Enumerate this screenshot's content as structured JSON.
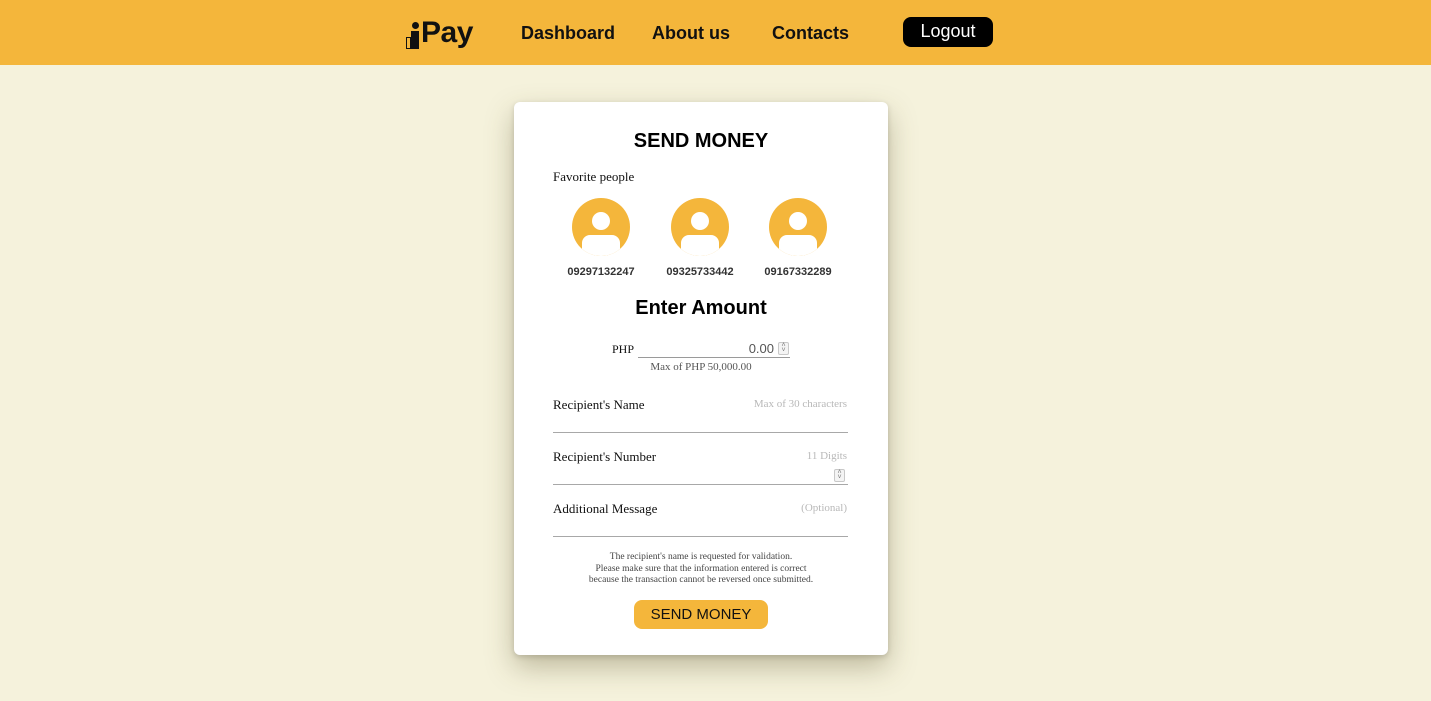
{
  "brand": {
    "name": "iPay",
    "text": "Pay",
    "accent_color": "#f4b63b",
    "background_color": "#f5f2dc"
  },
  "nav": {
    "links": [
      {
        "label": "Dashboard"
      },
      {
        "label": "About us"
      },
      {
        "label": "Contacts"
      }
    ],
    "logout_label": "Logout"
  },
  "send_money": {
    "title": "SEND MONEY",
    "favorites_label": "Favorite people",
    "favorites": [
      {
        "number": "09297132247",
        "icon": "user-avatar-icon"
      },
      {
        "number": "09325733442",
        "icon": "user-avatar-icon"
      },
      {
        "number": "09167332289",
        "icon": "user-avatar-icon"
      }
    ],
    "amount_title": "Enter Amount",
    "currency": "PHP",
    "amount_value": "0.00",
    "amount_hint": "Max of PHP 50,000.00",
    "fields": {
      "name": {
        "label": "Recipient's Name",
        "placeholder": "Max of 30 characters"
      },
      "number": {
        "label": "Recipient's Number",
        "placeholder": "11 Digits"
      },
      "message": {
        "label": "Additional Message",
        "placeholder": "(Optional)"
      }
    },
    "notice_lines": [
      "The recipient's name is requested for validation.",
      "Please make sure that the information entered is correct",
      "because the transaction cannot be reversed once submitted."
    ],
    "submit_label": "SEND MONEY"
  }
}
